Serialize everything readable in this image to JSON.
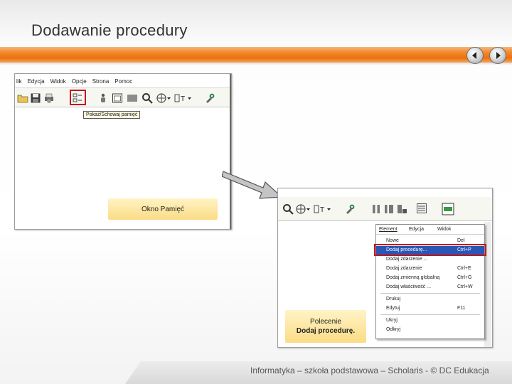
{
  "slide": {
    "title": "Dodawanie procedury",
    "accent_color": "#ec6f0e",
    "footer": "Informatyka – szkoła podstawowa – Scholaris - © DC Edukacja",
    "nav": {
      "prev_icon": "chevron-left-icon",
      "next_icon": "chevron-right-icon"
    }
  },
  "screenshot1": {
    "menu": [
      "lik",
      "Edycja",
      "Widok",
      "Opcje",
      "Strona",
      "Pomoc"
    ],
    "tooltip": "Pokaż/Schowaj pamięć",
    "panel_label": "Okno Pamięć"
  },
  "screenshot2": {
    "menubar": [
      "Element",
      "Edycja",
      "Widok"
    ],
    "menu_items": [
      {
        "label": "Nowe",
        "shortcut": "Del"
      },
      {
        "label": "Dodaj procedurę...",
        "shortcut": "Ctrl+P"
      },
      {
        "label": "Dodaj zdarzenie ...",
        "shortcut": ""
      },
      {
        "label": "Dodaj zdarzenie",
        "shortcut": "Ctrl+E"
      },
      {
        "label": "Dodaj zmienną globalną",
        "shortcut": "Ctrl+G"
      },
      {
        "label": "Dodaj właściwość ...",
        "shortcut": "Ctrl+W"
      },
      {
        "label": "Drukuj",
        "shortcut": ""
      },
      {
        "label": "Edytuj",
        "shortcut": "F11"
      },
      {
        "label": "Ukryj",
        "shortcut": ""
      },
      {
        "label": "Odkryj",
        "shortcut": ""
      }
    ],
    "selected_item": "Dodaj procedurę...",
    "panel_line1": "Polecenie",
    "panel_line2": "Dodaj procedurę."
  }
}
